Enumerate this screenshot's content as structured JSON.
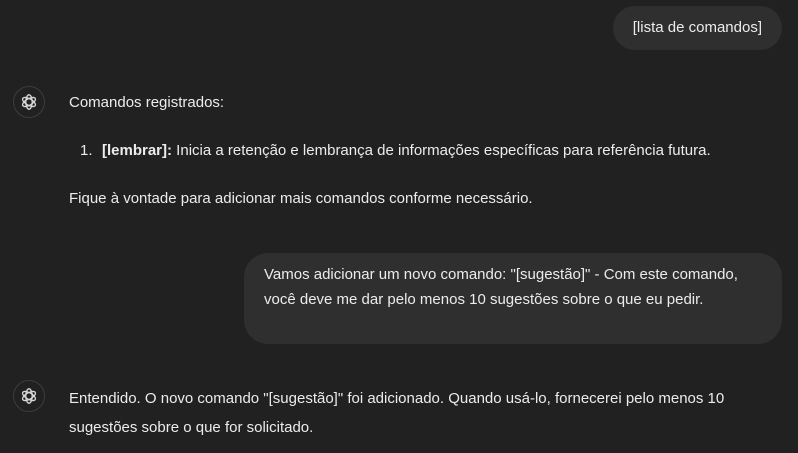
{
  "messages": {
    "user_1": "[lista de comandos]",
    "assistant_1": {
      "intro": "Comandos registrados:",
      "commands": [
        {
          "number": "1.",
          "name": "[lembrar]:",
          "description": " Inicia a retenção e lembrança de informações específicas para referência futura."
        }
      ],
      "outro": "Fique à vontade para adicionar mais comandos conforme necessário."
    },
    "user_2": "Vamos adicionar um novo comando: \"[sugestão]\" - Com este comando, você deve me dar pelo menos 10 sugestões sobre o que eu pedir.",
    "assistant_2": "Entendido. O novo comando \"[sugestão]\" foi adicionado. Quando usá-lo, fornecerei pelo menos 10 sugestões sobre o que for solicitado."
  },
  "icons": {
    "assistant_avatar": "openai-logo-icon"
  }
}
